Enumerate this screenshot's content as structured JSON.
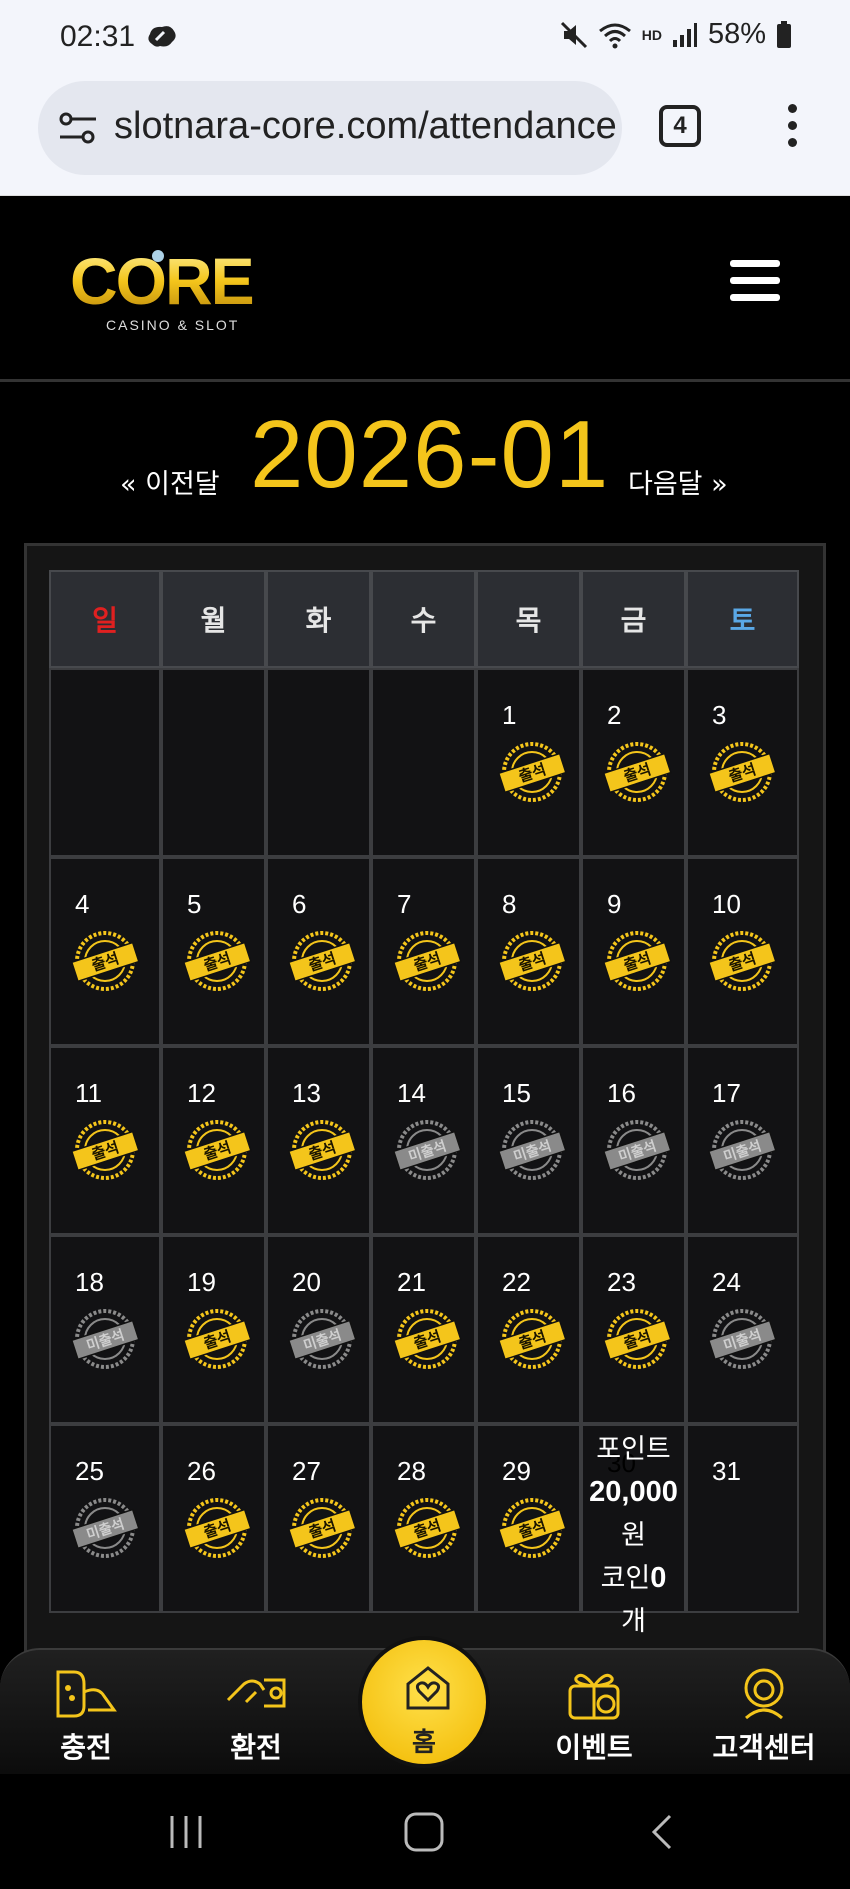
{
  "status_bar": {
    "time": "02:31",
    "battery": "58%",
    "hd_label": "HD"
  },
  "browser": {
    "url": "slotnara-core.com/attendance",
    "tab_count": "4"
  },
  "header": {
    "logo_text": "CORE",
    "logo_sub": "CASINO & SLOT"
  },
  "calendar": {
    "month_title": "2026-01",
    "prev_label": "« 이전달",
    "next_label": "다음달 »",
    "weekdays": [
      "일",
      "월",
      "화",
      "수",
      "목",
      "금",
      "토"
    ],
    "stamp_attended": "출석",
    "stamp_missed": "미출석",
    "reward": {
      "line1": "포인트",
      "amount": "20,000",
      "unit": "원",
      "coin_label": "코인",
      "coin_count": "0",
      "coin_unit": "개"
    },
    "days": [
      {
        "d": "",
        "s": ""
      },
      {
        "d": "",
        "s": ""
      },
      {
        "d": "",
        "s": ""
      },
      {
        "d": "",
        "s": ""
      },
      {
        "d": "1",
        "s": "attended"
      },
      {
        "d": "2",
        "s": "attended"
      },
      {
        "d": "3",
        "s": "attended"
      },
      {
        "d": "4",
        "s": "attended"
      },
      {
        "d": "5",
        "s": "attended"
      },
      {
        "d": "6",
        "s": "attended"
      },
      {
        "d": "7",
        "s": "attended"
      },
      {
        "d": "8",
        "s": "attended"
      },
      {
        "d": "9",
        "s": "attended"
      },
      {
        "d": "10",
        "s": "attended"
      },
      {
        "d": "11",
        "s": "attended"
      },
      {
        "d": "12",
        "s": "attended"
      },
      {
        "d": "13",
        "s": "attended"
      },
      {
        "d": "14",
        "s": "missed"
      },
      {
        "d": "15",
        "s": "missed"
      },
      {
        "d": "16",
        "s": "missed"
      },
      {
        "d": "17",
        "s": "missed"
      },
      {
        "d": "18",
        "s": "missed"
      },
      {
        "d": "19",
        "s": "attended"
      },
      {
        "d": "20",
        "s": "missed"
      },
      {
        "d": "21",
        "s": "attended"
      },
      {
        "d": "22",
        "s": "attended"
      },
      {
        "d": "23",
        "s": "attended"
      },
      {
        "d": "24",
        "s": "missed"
      },
      {
        "d": "25",
        "s": "missed"
      },
      {
        "d": "26",
        "s": "attended"
      },
      {
        "d": "27",
        "s": "attended"
      },
      {
        "d": "28",
        "s": "attended"
      },
      {
        "d": "29",
        "s": "attended"
      },
      {
        "d": "30",
        "s": "reward"
      },
      {
        "d": "31",
        "s": ""
      }
    ]
  },
  "bottom_nav": {
    "charge": "충전",
    "exchange": "환전",
    "home": "홈",
    "event": "이벤트",
    "support": "고객센터"
  },
  "colors": {
    "gold": "#f4c51b",
    "sunday": "#e02020",
    "saturday": "#5aa8e6",
    "missed": "#8a8a8a"
  }
}
